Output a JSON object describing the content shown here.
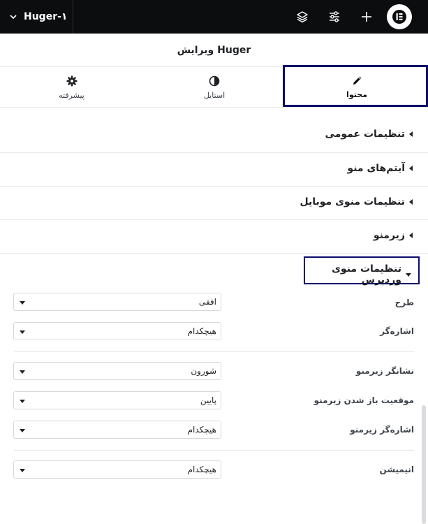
{
  "topbar": {
    "document_title": "Huger-۱",
    "icons": [
      "chevron-down-icon",
      "layers-icon",
      "sliders-icon",
      "plus-icon",
      "elementor-logo-icon"
    ]
  },
  "panel": {
    "title": "ویرایش Huger"
  },
  "tabs": [
    {
      "label": "محتوا",
      "icon": "pencil-icon",
      "active": true
    },
    {
      "label": "استایل",
      "icon": "contrast-icon",
      "active": false
    },
    {
      "label": "پیشرفته",
      "icon": "gear-icon",
      "active": false
    }
  ],
  "sections": [
    {
      "label": "تنظیمات عمومی",
      "open": false
    },
    {
      "label": "آیتم‌های منو",
      "open": false
    },
    {
      "label": "تنظیمات منوی موبایل",
      "open": false
    },
    {
      "label": "زیرمنو",
      "open": false
    },
    {
      "label": "تنظیمات منوی وردپرس",
      "open": true
    }
  ],
  "controls": {
    "layout": {
      "label": "طرح",
      "value": "افقی"
    },
    "pointer": {
      "label": "اشاره‌گر",
      "value": "هیچکدام"
    },
    "submenu_indicator": {
      "label": "نشانگر زیرمنو",
      "value": "شورون"
    },
    "submenu_position": {
      "label": "موقعیت باز شدن زیرمنو",
      "value": "پایین"
    },
    "submenu_pointer": {
      "label": "اشاره‌گر زیرمنو",
      "value": "هیچکدام"
    },
    "animation": {
      "label": "انیمیشن",
      "value": "هیچکدام"
    }
  },
  "colors": {
    "topbar": "#0c0d0e",
    "highlight": "#0a0a6b",
    "border": "#e6e8ea"
  }
}
